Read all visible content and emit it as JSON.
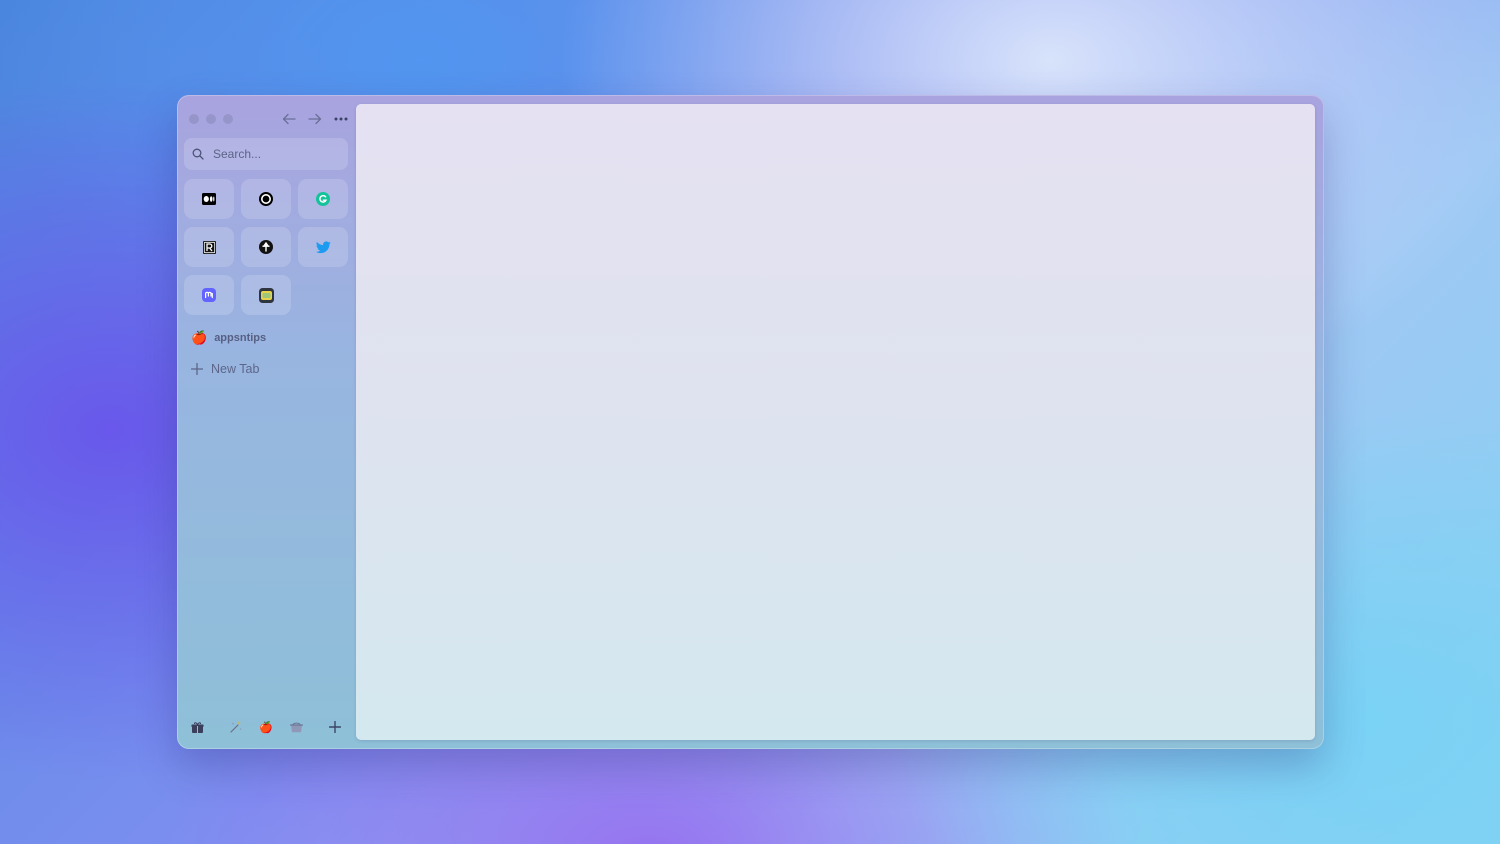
{
  "sidebar": {
    "search": {
      "placeholder": "Search..."
    },
    "favorites": [
      {
        "name": "medium",
        "icon": "medium-icon"
      },
      {
        "name": "threads",
        "icon": "threads-icon"
      },
      {
        "name": "grammarly",
        "icon": "grammarly-icon"
      },
      {
        "name": "reeder",
        "icon": "reeder-icon"
      },
      {
        "name": "tumblr-like",
        "icon": "dark-circle-t-icon"
      },
      {
        "name": "twitter",
        "icon": "twitter-icon"
      },
      {
        "name": "mastodon",
        "icon": "mastodon-icon"
      },
      {
        "name": "app",
        "icon": "yellow-app-icon"
      }
    ],
    "space": {
      "emoji": "🍎",
      "label": "appsntips"
    },
    "new_tab": {
      "label": "New Tab"
    },
    "spaces_switcher": [
      {
        "icon": "gift-icon"
      },
      {
        "icon": "sparkle-icon"
      },
      {
        "icon": "apple-icon"
      },
      {
        "icon": "box-icon"
      }
    ]
  },
  "colors": {
    "twitter": "#1d9bf0",
    "grammarly": "#15c39a",
    "mastodon": "#6364ff"
  }
}
